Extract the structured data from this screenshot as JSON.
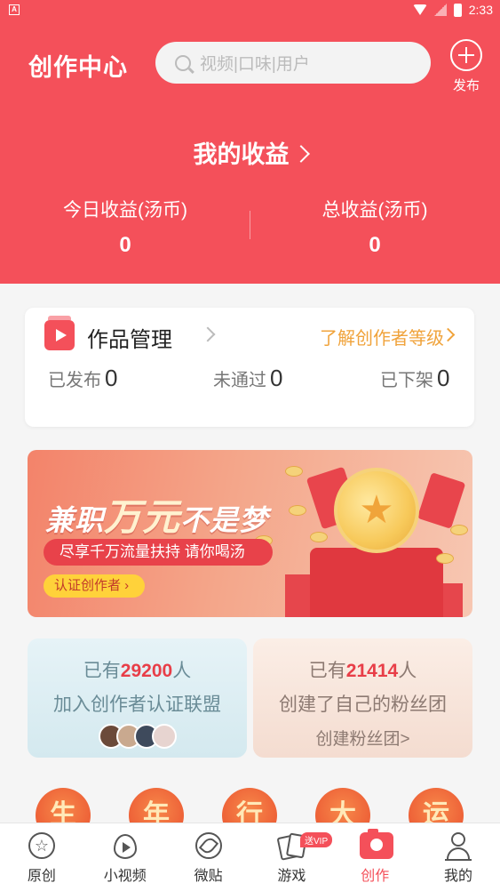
{
  "status_bar": {
    "time": "2:33"
  },
  "header": {
    "title": "创作中心",
    "search_placeholder": "视频|口味|用户",
    "publish_label": "发布"
  },
  "income": {
    "title": "我的收益",
    "today_label": "今日收益(汤币)",
    "today_value": "0",
    "total_label": "总收益(汤币)",
    "total_value": "0"
  },
  "works": {
    "title": "作品管理",
    "level_link": "了解创作者等级",
    "published_label": "已发布",
    "published_value": "0",
    "rejected_label": "未通过",
    "rejected_value": "0",
    "removed_label": "已下架",
    "removed_value": "0"
  },
  "banner": {
    "headline_1": "兼职",
    "headline_2": "万元",
    "headline_3": "不是梦",
    "subline": "尽享千万流量扶持 请你喝汤",
    "button": "认证创作者"
  },
  "alliance_card": {
    "prefix": "已有",
    "count": "29200",
    "suffix": "人",
    "line2": "加入创作者认证联盟"
  },
  "fan_card": {
    "prefix": "已有",
    "count": "21414",
    "suffix": "人",
    "line2": "创建了自己的粉丝团",
    "line3": "创建粉丝团>"
  },
  "festive_chars": [
    "生",
    "年",
    "行",
    "大",
    "运"
  ],
  "bottom_nav": {
    "items": [
      {
        "label": "原创",
        "icon": "star-circle-icon"
      },
      {
        "label": "小视频",
        "icon": "video-drop-icon"
      },
      {
        "label": "微贴",
        "icon": "compass-icon"
      },
      {
        "label": "游戏",
        "icon": "cards-icon",
        "badge": "送VIP"
      },
      {
        "label": "创作",
        "icon": "camera-icon",
        "active": true
      },
      {
        "label": "我的",
        "icon": "person-icon"
      }
    ]
  },
  "colors": {
    "brand": "#f4505a",
    "accent": "#f0a33b",
    "highlight": "#e83e48"
  }
}
